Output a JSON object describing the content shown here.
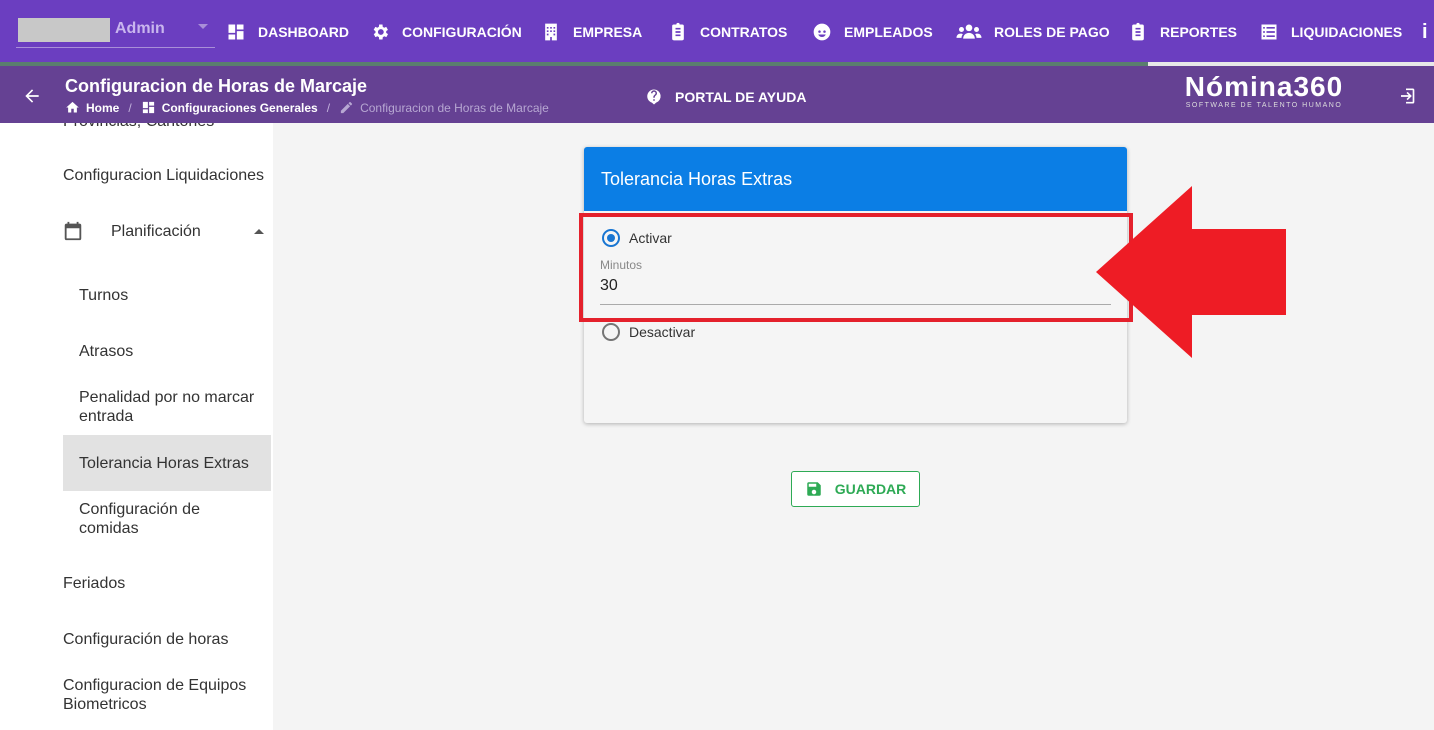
{
  "topnav": {
    "user_name": "Admin",
    "items": [
      {
        "label": "DASHBOARD",
        "icon": "dashboard-icon"
      },
      {
        "label": "CONFIGURACIÓN",
        "icon": "gear-icon"
      },
      {
        "label": "EMPRESA",
        "icon": "building-icon"
      },
      {
        "label": "CONTRATOS",
        "icon": "clipboard-icon"
      },
      {
        "label": "EMPLEADOS",
        "icon": "face-icon"
      },
      {
        "label": "ROLES DE PAGO",
        "icon": "users-icon"
      },
      {
        "label": "REPORTES",
        "icon": "report-icon"
      },
      {
        "label": "LIQUIDACIONES",
        "icon": "list-icon"
      }
    ]
  },
  "header": {
    "title": "Configuracion de Horas de Marcaje",
    "breadcrumb": {
      "home": "Home",
      "section": "Configuraciones Generales",
      "current": "Configuracion de Horas de Marcaje"
    },
    "help_label": "PORTAL DE AYUDA",
    "brand_name": "Nómina360",
    "brand_tagline": "SOFTWARE DE TALENTO HUMANO"
  },
  "sidebar": {
    "partial_top": "Provincias, Cantones",
    "items": {
      "liquidaciones": "Configuracion Liquidaciones",
      "planificacion": "Planificación",
      "turnos": "Turnos",
      "atrasos": "Atrasos",
      "penalidad": "Penalidad por no marcar entrada",
      "tolerancia": "Tolerancia Horas Extras",
      "comidas": "Configuración de comidas",
      "feriados": "Feriados",
      "horas": "Configuración de horas",
      "equipos": "Configuracion de Equipos Biometricos"
    }
  },
  "card": {
    "title": "Tolerancia Horas Extras",
    "activate_label": "Activar",
    "activate_selected": true,
    "minutes_label": "Minutos",
    "minutes_value": "30",
    "deactivate_label": "Desactivar"
  },
  "actions": {
    "save_label": "GUARDAR"
  },
  "colors": {
    "topnav": "#6b3ec0",
    "header": "#654193",
    "card_header": "#0b7ee5",
    "highlight": "#e4212c",
    "save": "#2eaa55"
  }
}
